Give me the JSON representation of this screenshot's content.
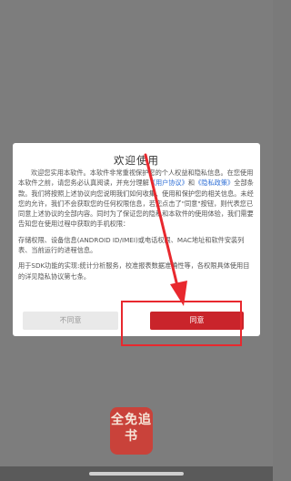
{
  "dialog": {
    "title": "欢迎使用",
    "intro_pre": "欢迎您实用本软件。本软件非常重视保护您的个人权益和隐私信息。在您使用本软件之前，请您务必认真阅读，并充分理解",
    "link_user_agreement": "《用户协议》",
    "intro_and": "和",
    "link_privacy_policy": "《隐私政策》",
    "intro_post": "全部条款。我们将按照上述协议向您说明我们如何收集、使用和保护您的相关信息。未经您的允许，我们不会获取您的任何权限信息，若您点击了\"同意\"按钮，则代表您已同意上述协议的全部内容。同时为了保证您的隐私和本软件的使用体验，我们需要告知您在使用过程中获取的手机权限：",
    "permissions_text": "存储权限、设备信息(ANDROID ID/IMEI)或电话权限、MAC地址和软件安装列表、当前运行的进程信息。",
    "sdk_text": "用于SDK功能的实现:统计分析服务，校准报表数据准确性等，各权限具体使用目的详见隐私协议第七条。",
    "disagree_label": "不同意",
    "agree_label": "同意"
  },
  "app_icon": {
    "text": "全免追书"
  },
  "colors": {
    "overlay": "#7d7d7d",
    "agree_button": "#c9242b",
    "link": "#2f6fd6",
    "annotation": "#e8282e"
  }
}
